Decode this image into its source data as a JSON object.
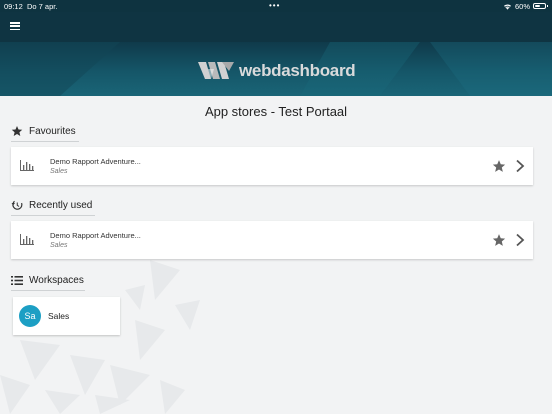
{
  "status_bar": {
    "time": "09:12",
    "date": "Do 7 apr.",
    "dots": "•••",
    "battery": "60%",
    "battery_level": 0.6
  },
  "header": {
    "logo_text": "webdashboard",
    "menu_icon": "hamburger-icon"
  },
  "page": {
    "title": "App stores - Test Portaal"
  },
  "favourites": {
    "title": "Favourites",
    "icon": "star-icon",
    "items": [
      {
        "name": "Demo Rapport Adventure...",
        "category": "Sales",
        "icon": "bar-chart-icon"
      }
    ]
  },
  "recently_used": {
    "title": "Recently used",
    "icon": "history-icon",
    "items": [
      {
        "name": "Demo Rapport Adventure...",
        "category": "Sales",
        "icon": "bar-chart-icon"
      }
    ]
  },
  "workspaces": {
    "title": "Workspaces",
    "icon": "list-icon",
    "items": [
      {
        "initials": "Sa",
        "name": "Sales"
      }
    ]
  },
  "colors": {
    "header_bg": "#0f3442",
    "banner_bg": "#155668",
    "avatar_bg": "#1c9fc4",
    "page_bg": "#f2f3f4"
  }
}
